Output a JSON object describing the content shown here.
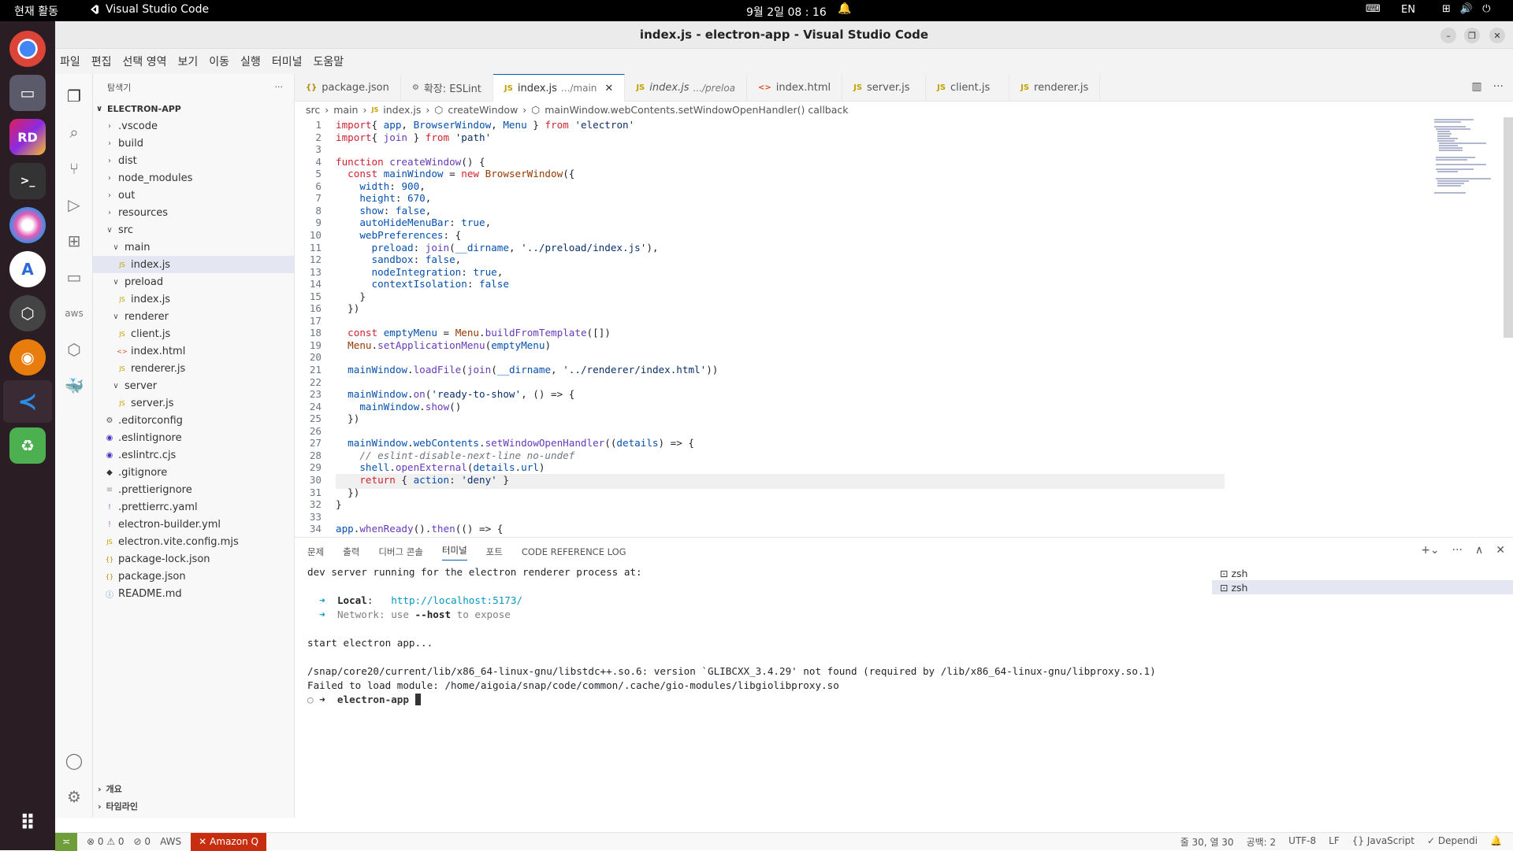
{
  "topbar": {
    "activities": "현재 활동",
    "app_name": "Visual Studio Code",
    "clock": "9월 2일 08 : 16",
    "lang": "EN"
  },
  "window": {
    "title": "index.js - electron-app - Visual Studio Code"
  },
  "menu": [
    "파일",
    "편집",
    "선택 영역",
    "보기",
    "이동",
    "실행",
    "터미널",
    "도움말"
  ],
  "sidebar": {
    "header": "탐색기",
    "project": "ELECTRON-APP",
    "tree": [
      {
        "label": ".vscode",
        "kind": "folder-closed",
        "depth": 0
      },
      {
        "label": "build",
        "kind": "folder-closed",
        "depth": 0
      },
      {
        "label": "dist",
        "kind": "folder-closed",
        "depth": 0
      },
      {
        "label": "node_modules",
        "kind": "folder-closed",
        "depth": 0
      },
      {
        "label": "out",
        "kind": "folder-closed",
        "depth": 0
      },
      {
        "label": "resources",
        "kind": "folder-closed",
        "depth": 0
      },
      {
        "label": "src",
        "kind": "folder-open",
        "depth": 0
      },
      {
        "label": "main",
        "kind": "folder-open",
        "depth": 1
      },
      {
        "label": "index.js",
        "kind": "js",
        "depth": 2,
        "selected": true
      },
      {
        "label": "preload",
        "kind": "folder-open",
        "depth": 1
      },
      {
        "label": "index.js",
        "kind": "js",
        "depth": 2
      },
      {
        "label": "renderer",
        "kind": "folder-open",
        "depth": 1
      },
      {
        "label": "client.js",
        "kind": "js",
        "depth": 2
      },
      {
        "label": "index.html",
        "kind": "html",
        "depth": 2
      },
      {
        "label": "renderer.js",
        "kind": "js",
        "depth": 2
      },
      {
        "label": "server",
        "kind": "folder-open",
        "depth": 1
      },
      {
        "label": "server.js",
        "kind": "js",
        "depth": 2
      },
      {
        "label": ".editorconfig",
        "kind": "gear",
        "depth": 0
      },
      {
        "label": ".eslintignore",
        "kind": "eslint",
        "depth": 0
      },
      {
        "label": ".eslintrc.cjs",
        "kind": "eslint",
        "depth": 0
      },
      {
        "label": ".gitignore",
        "kind": "git",
        "depth": 0
      },
      {
        "label": ".prettierignore",
        "kind": "lines",
        "depth": 0
      },
      {
        "label": ".prettierrc.yaml",
        "kind": "yaml",
        "depth": 0
      },
      {
        "label": "electron-builder.yml",
        "kind": "yaml",
        "depth": 0
      },
      {
        "label": "electron.vite.config.mjs",
        "kind": "js",
        "depth": 0
      },
      {
        "label": "package-lock.json",
        "kind": "json",
        "depth": 0
      },
      {
        "label": "package.json",
        "kind": "json",
        "depth": 0
      },
      {
        "label": "README.md",
        "kind": "info",
        "depth": 0
      }
    ],
    "outline": "개요",
    "timeline": "타임라인"
  },
  "tabs": [
    {
      "type": "{}",
      "label": "package.json",
      "color": "#b58900"
    },
    {
      "type": "⚙",
      "label": "확장: ESLint",
      "color": "#666666"
    },
    {
      "type": "JS",
      "label": "index.js",
      "desc": ".../main",
      "active": true,
      "color": "#c3a100"
    },
    {
      "type": "JS",
      "label": "index.js",
      "desc": ".../preloa",
      "italic": true,
      "color": "#c3a100"
    },
    {
      "type": "<>",
      "label": "index.html",
      "color": "#e44d26"
    },
    {
      "type": "JS",
      "label": "server.js",
      "color": "#c3a100"
    },
    {
      "type": "JS",
      "label": "client.js",
      "color": "#c3a100"
    },
    {
      "type": "JS",
      "label": "renderer.js",
      "color": "#c3a100"
    }
  ],
  "breadcrumb": [
    "src",
    "main",
    "index.js",
    "createWindow",
    "mainWindow.webContents.setWindowOpenHandler() callback"
  ],
  "code": [
    [
      [
        "k",
        "import"
      ],
      [
        "",
        "{ "
      ],
      [
        "v",
        "app"
      ],
      [
        "",
        ", "
      ],
      [
        "v",
        "BrowserWindow"
      ],
      [
        "",
        ", "
      ],
      [
        "v",
        "Menu"
      ],
      [
        "",
        " } "
      ],
      [
        "k",
        "from"
      ],
      [
        "s",
        " 'electron'"
      ]
    ],
    [
      [
        "k",
        "import"
      ],
      [
        "",
        "{ "
      ],
      [
        "f",
        "join"
      ],
      [
        "",
        " } "
      ],
      [
        "k",
        "from"
      ],
      [
        "s",
        " 'path'"
      ]
    ],
    [],
    [
      [
        "k",
        "function"
      ],
      [
        "",
        " "
      ],
      [
        "f",
        "createWindow"
      ],
      [
        "",
        "() {"
      ]
    ],
    [
      [
        "",
        "  "
      ],
      [
        "k",
        "const"
      ],
      [
        "",
        " "
      ],
      [
        "v",
        "mainWindow"
      ],
      [
        "",
        " = "
      ],
      [
        "k",
        "new"
      ],
      [
        "",
        " "
      ],
      [
        "p",
        "BrowserWindow"
      ],
      [
        "",
        "({"
      ]
    ],
    [
      [
        "",
        "    "
      ],
      [
        "v",
        "width"
      ],
      [
        "",
        ": "
      ],
      [
        "n",
        "900"
      ],
      [
        "",
        ","
      ]
    ],
    [
      [
        "",
        "    "
      ],
      [
        "v",
        "height"
      ],
      [
        "",
        ": "
      ],
      [
        "n",
        "670"
      ],
      [
        "",
        ","
      ]
    ],
    [
      [
        "",
        "    "
      ],
      [
        "v",
        "show"
      ],
      [
        "",
        ": "
      ],
      [
        "n",
        "false"
      ],
      [
        "",
        ","
      ]
    ],
    [
      [
        "",
        "    "
      ],
      [
        "v",
        "autoHideMenuBar"
      ],
      [
        "",
        ": "
      ],
      [
        "n",
        "true"
      ],
      [
        "",
        ","
      ]
    ],
    [
      [
        "",
        "    "
      ],
      [
        "v",
        "webPreferences"
      ],
      [
        "",
        ": {"
      ]
    ],
    [
      [
        "",
        "      "
      ],
      [
        "v",
        "preload"
      ],
      [
        "",
        ": "
      ],
      [
        "f",
        "join"
      ],
      [
        "",
        "("
      ],
      [
        "v",
        "__dirname"
      ],
      [
        "",
        ", "
      ],
      [
        "s",
        "'../preload/index.js'"
      ],
      [
        "",
        "),"
      ]
    ],
    [
      [
        "",
        "      "
      ],
      [
        "v",
        "sandbox"
      ],
      [
        "",
        ": "
      ],
      [
        "n",
        "false"
      ],
      [
        "",
        ","
      ]
    ],
    [
      [
        "",
        "      "
      ],
      [
        "v",
        "nodeIntegration"
      ],
      [
        "",
        ": "
      ],
      [
        "n",
        "true"
      ],
      [
        "",
        ","
      ]
    ],
    [
      [
        "",
        "      "
      ],
      [
        "v",
        "contextIsolation"
      ],
      [
        "",
        ": "
      ],
      [
        "n",
        "false"
      ]
    ],
    [
      [
        "",
        "    }"
      ]
    ],
    [
      [
        "",
        "  })"
      ]
    ],
    [],
    [
      [
        "",
        "  "
      ],
      [
        "k",
        "const"
      ],
      [
        "",
        " "
      ],
      [
        "v",
        "emptyMenu"
      ],
      [
        "",
        " = "
      ],
      [
        "p",
        "Menu"
      ],
      [
        "",
        "."
      ],
      [
        "f",
        "buildFromTemplate"
      ],
      [
        "",
        "([])"
      ]
    ],
    [
      [
        "",
        "  "
      ],
      [
        "p",
        "Menu"
      ],
      [
        "",
        "."
      ],
      [
        "f",
        "setApplicationMenu"
      ],
      [
        "",
        "("
      ],
      [
        "v",
        "emptyMenu"
      ],
      [
        "",
        ")"
      ]
    ],
    [],
    [
      [
        "",
        "  "
      ],
      [
        "v",
        "mainWindow"
      ],
      [
        "",
        "."
      ],
      [
        "f",
        "loadFile"
      ],
      [
        "",
        "("
      ],
      [
        "f",
        "join"
      ],
      [
        "",
        "("
      ],
      [
        "v",
        "__dirname"
      ],
      [
        "",
        ", "
      ],
      [
        "s",
        "'../renderer/index.html'"
      ],
      [
        "",
        "))"
      ]
    ],
    [],
    [
      [
        "",
        "  "
      ],
      [
        "v",
        "mainWindow"
      ],
      [
        "",
        "."
      ],
      [
        "f",
        "on"
      ],
      [
        "",
        "("
      ],
      [
        "s",
        "'ready-to-show'"
      ],
      [
        "",
        ", () => {"
      ]
    ],
    [
      [
        "",
        "    "
      ],
      [
        "v",
        "mainWindow"
      ],
      [
        "",
        "."
      ],
      [
        "f",
        "show"
      ],
      [
        "",
        "()"
      ]
    ],
    [
      [
        "",
        "  })"
      ]
    ],
    [],
    [
      [
        "",
        "  "
      ],
      [
        "v",
        "mainWindow"
      ],
      [
        "",
        "."
      ],
      [
        "v",
        "webContents"
      ],
      [
        "",
        "."
      ],
      [
        "f",
        "setWindowOpenHandler"
      ],
      [
        "",
        "(("
      ],
      [
        "v",
        "details"
      ],
      [
        "",
        ") => {"
      ]
    ],
    [
      [
        "",
        "    "
      ],
      [
        "c",
        "// eslint-disable-next-line no-undef"
      ]
    ],
    [
      [
        "",
        "    "
      ],
      [
        "v",
        "shell"
      ],
      [
        "",
        "."
      ],
      [
        "f",
        "openExternal"
      ],
      [
        "",
        "("
      ],
      [
        "v",
        "details"
      ],
      [
        "",
        "."
      ],
      [
        "v",
        "url"
      ],
      [
        "",
        ")"
      ]
    ],
    [
      [
        "",
        "    "
      ],
      [
        "k",
        "return"
      ],
      [
        "",
        " { "
      ],
      [
        "v",
        "action"
      ],
      [
        "",
        ": "
      ],
      [
        "s",
        "'deny'"
      ],
      [
        "",
        " }"
      ]
    ],
    [
      [
        "",
        "  })"
      ]
    ],
    [
      [
        "",
        "}"
      ]
    ],
    [],
    [
      [
        "v",
        "app"
      ],
      [
        "",
        "."
      ],
      [
        "f",
        "whenReady"
      ],
      [
        "",
        "()."
      ],
      [
        "f",
        "then"
      ],
      [
        "",
        "(() => {"
      ]
    ]
  ],
  "current_line": 30,
  "panel": {
    "tabs": [
      "문제",
      "출력",
      "디버그 콘솔",
      "터미널",
      "포트",
      "CODE REFERENCE LOG"
    ],
    "active_tab": "터미널",
    "terminal": {
      "l1": "dev server running for the electron renderer process at:",
      "local_label": "Local",
      "local_url": "http://localhost:5173/",
      "network_label": "Network",
      "network_text_a": "use ",
      "network_flag": "--host",
      "network_text_b": " to expose",
      "l4": "start electron app...",
      "l5": "/snap/core20/current/lib/x86_64-linux-gnu/libstdc++.so.6: version `GLIBCXX_3.4.29' not found (required by /lib/x86_64-linux-gnu/libproxy.so.1)",
      "l6": "Failed to load module: /home/aigoia/snap/code/common/.cache/gio-modules/libgiolibproxy.so",
      "prompt_dir": "electron-app"
    },
    "terminal_list": [
      "zsh",
      "zsh"
    ]
  },
  "status": {
    "problems": "0",
    "warnings": "0",
    "ports": "0",
    "aws": "AWS",
    "amazonq": "Amazon Q",
    "position": "줄 30, 열 30",
    "spaces": "공백: 2",
    "encoding": "UTF-8",
    "eol": "LF",
    "language": "JavaScript",
    "dependi": "Dependi"
  }
}
